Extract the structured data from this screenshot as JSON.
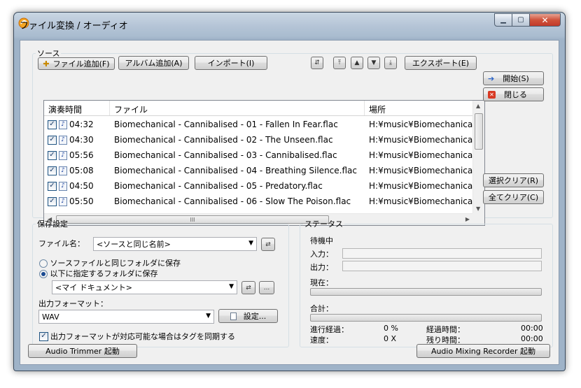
{
  "window": {
    "title": "ファイル変換 / オーディオ"
  },
  "source": {
    "legend": "ソース",
    "add_file_label": "ファイル追加(F)",
    "add_album_label": "アルバム追加(A)",
    "import_label": "インポート(I)",
    "export_label": "エクスポート(E)",
    "columns": [
      "演奏時間",
      "ファイル",
      "場所"
    ],
    "rows": [
      {
        "time": "04:32",
        "file": "Biomechanical - Cannibalised - 01 - Fallen In Fear.flac",
        "location": "H:¥music¥Biomechanical"
      },
      {
        "time": "04:30",
        "file": "Biomechanical - Cannibalised - 02 - The Unseen.flac",
        "location": "H:¥music¥Biomechanical"
      },
      {
        "time": "05:56",
        "file": "Biomechanical - Cannibalised - 03 - Cannibalised.flac",
        "location": "H:¥music¥Biomechanical"
      },
      {
        "time": "05:08",
        "file": "Biomechanical - Cannibalised - 04 - Breathing Silence.flac",
        "location": "H:¥music¥Biomechanical"
      },
      {
        "time": "04:50",
        "file": "Biomechanical - Cannibalised - 05 - Predatory.flac",
        "location": "H:¥music¥Biomechanical"
      },
      {
        "time": "05:50",
        "file": "Biomechanical - Cannibalised - 06 - Slow The Poison.flac",
        "location": "H:¥music¥Biomechanical"
      }
    ],
    "hscroll_grip": "III"
  },
  "side": {
    "start_label": "開始(S)",
    "close_label": "閉じる",
    "clear_selection_label": "選択クリア(R)",
    "clear_all_label": "全てクリア(C)"
  },
  "save": {
    "legend": "保存設定",
    "filename_label": "ファイル名：",
    "filename_value": "<ソースと同じ名前>",
    "radio_same_folder": "ソースファイルと同じフォルダに保存",
    "radio_specified_folder": "以下に指定するフォルダに保存",
    "folder_value": "<マイ ドキュメント>",
    "folder_browse_label": "...",
    "output_format_label": "出力フォーマット：",
    "format_value": "WAV",
    "settings_label": "設定...",
    "sync_tags_label": "出力フォーマットが対応可能な場合はタグを同期する"
  },
  "status": {
    "legend": "ステータス",
    "state": "待機中",
    "input_label": "入力：",
    "output_label": "出力：",
    "current_label": "現在：",
    "total_label": "合計：",
    "progress_label": "進行経過：",
    "progress_value": "0 %",
    "elapsed_label": "経過時間：",
    "elapsed_value": "00:00",
    "speed_label": "速度：",
    "speed_value": "0 X",
    "remaining_label": "残り時間：",
    "remaining_value": "00:00",
    "current_progress": 0,
    "total_progress": 0
  },
  "footer": {
    "trimmer_label": "Audio Trimmer 起動",
    "mixing_label": "Audio Mixing Recorder 起動"
  }
}
